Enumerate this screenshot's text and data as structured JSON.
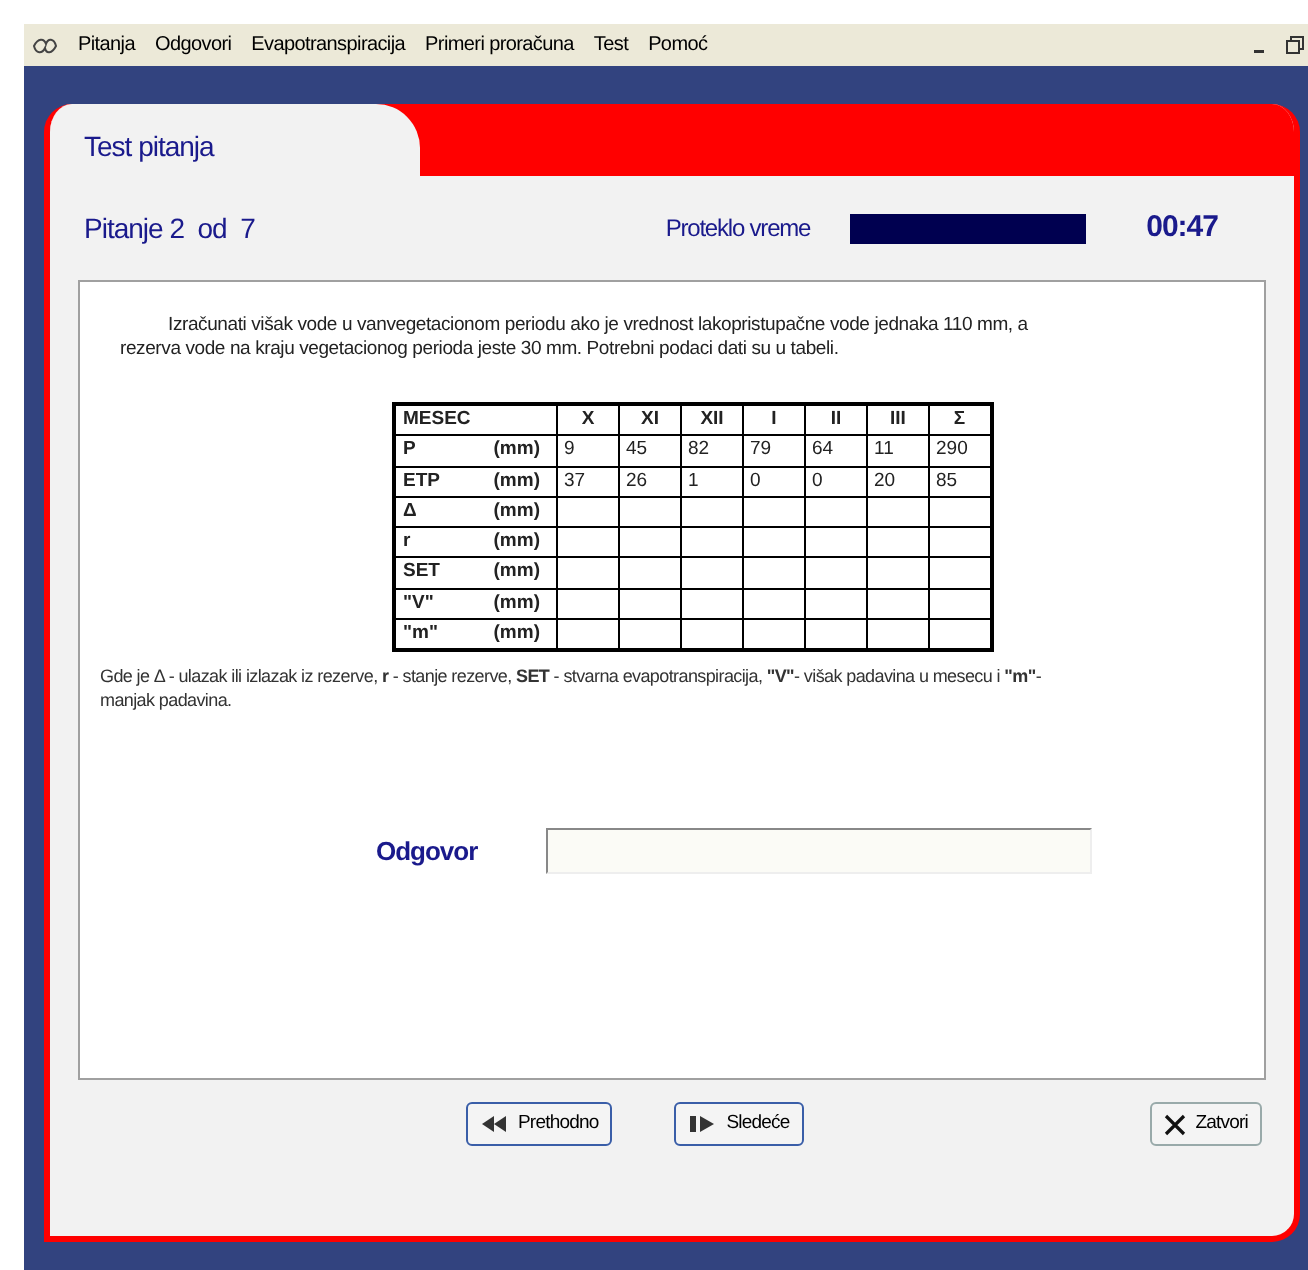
{
  "menu_bar": {
    "items": [
      "Pitanja",
      "Odgovori",
      "Evapotranspiracija",
      "Primeri proračuna",
      "Test",
      "Pomoć"
    ]
  },
  "panel": {
    "title": "Test pitanja",
    "question_counter": "Pitanje 2  od  7",
    "elapsed_label": "Proteklo vreme",
    "elapsed": {
      "level": 1
    },
    "timer": "00:47"
  },
  "question": {
    "text": "Izračunati višak vode u vanvegetacionom periodu ako je vrednost lakopristupačne vode jednaka 110 mm, a rezerva vode na kraju vegetacionog perioda jeste 30 mm. Potrebni podaci dati su u tabeli.",
    "table": {
      "columns": [
        "MESEC",
        "X",
        "XI",
        "XII",
        "I",
        "II",
        "III",
        "Σ"
      ],
      "rows": [
        {
          "label": "P",
          "unit": "(mm)",
          "cells": [
            "9",
            "45",
            "82",
            "79",
            "64",
            "11",
            "290"
          ]
        },
        {
          "label": "ETP",
          "unit": "(mm)",
          "cells": [
            "37",
            "26",
            "1",
            "0",
            "0",
            "20",
            "85"
          ]
        },
        {
          "label": "Δ",
          "unit": "(mm)"
        },
        {
          "label": "r",
          "unit": "(mm)"
        },
        {
          "label": "SET",
          "unit": "(mm)"
        },
        {
          "label": "\"V\"",
          "unit": "(mm)"
        },
        {
          "label": "\"m\"",
          "unit": "(mm)"
        }
      ]
    },
    "footnote": "Gde je Δ - ulazak ili izlazak iz rezerve, **r** - stanje rezerve, **SET** - stvarna evapotranspiracija, **\"V\"**- višak padavina u mesecu i **\"m\"**- manjak padavina."
  },
  "answer": {
    "label": "Odgovor"
  },
  "buttons": [
    {
      "label": "Prethodno",
      "kind": "prev"
    },
    {
      "label": "Sledeće",
      "kind": "next"
    },
    {
      "label": "Zatvori",
      "kind": "close"
    }
  ]
}
